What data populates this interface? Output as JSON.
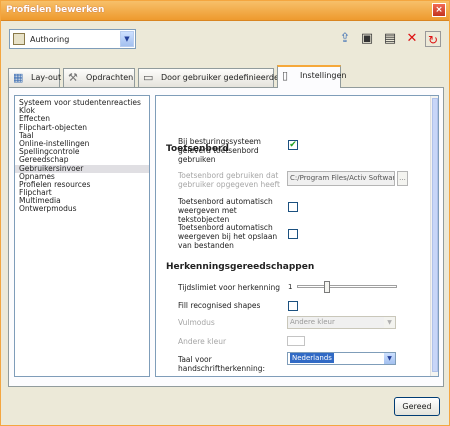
{
  "window": {
    "title": "Profielen bewerken",
    "close_glyph": "×"
  },
  "toolbar": {
    "profile": "Authoring",
    "icons": [
      "export-icon",
      "save-icon",
      "save-as-icon",
      "delete-icon",
      "refresh-icon"
    ]
  },
  "tabs": [
    {
      "label": "Lay-out",
      "icon": "layout-icon"
    },
    {
      "label": "Opdrachten",
      "icon": "commands-icon"
    },
    {
      "label": "Door gebruiker gedefinieerde knoppen",
      "icon": "user-buttons-icon"
    },
    {
      "label": "Instellingen",
      "icon": "settings-icon",
      "active": true
    }
  ],
  "categories": [
    "Systeem voor studentenreacties",
    "Klok",
    "Effecten",
    "Flipchart-objecten",
    "Taal",
    "Online-instellingen",
    "Spellingcontrole",
    "Gereedschap",
    "Gebruikersinvoer",
    "Opnames",
    "Profielen resources",
    "Flipchart",
    "Multimedia",
    "Ontwerpmodus"
  ],
  "selected_category": "Gebruikersinvoer",
  "keyboard": {
    "heading": "Toetsenbord",
    "use_os_keyboard": "Bij besturingssysteem geleverd toetsenbord gebruiken",
    "use_os_keyboard_checked": true,
    "use_keyboard_path": "Toetsenbord gebruiken dat gebruiker opgegeven heeft",
    "path_value": "C:/Program Files/Activ Software/In",
    "browse": "...",
    "auto_show_text": "Toetsenbord automatisch weergeven met tekstobjecten",
    "auto_show_text_checked": false,
    "auto_show_save": "Toetsenbord automatisch weergeven bij het opslaan van bestanden",
    "auto_show_save_checked": false
  },
  "recognition": {
    "heading": "Herkenningsgereedschappen",
    "time_limit_label": "Tijdslimiet voor herkenning",
    "time_limit_value": "1",
    "time_limit_fraction": 0.28,
    "fill_shapes_label": "Fill recognised shapes",
    "fill_shapes_checked": false,
    "fill_mode_label": "Vulmodus",
    "fill_mode_value": "Andere kleur",
    "other_color_label": "Andere kleur",
    "handwriting_lang_label": "Taal voor handschriftherkenning:",
    "handwriting_lang_value": "Nederlands"
  },
  "footer": {
    "done": "Gereed"
  },
  "colors": {
    "title_bar": "#ee9a2e",
    "active_tab": "#f5a83a",
    "selection": "#316ac5",
    "checkmark": "#21a121"
  }
}
